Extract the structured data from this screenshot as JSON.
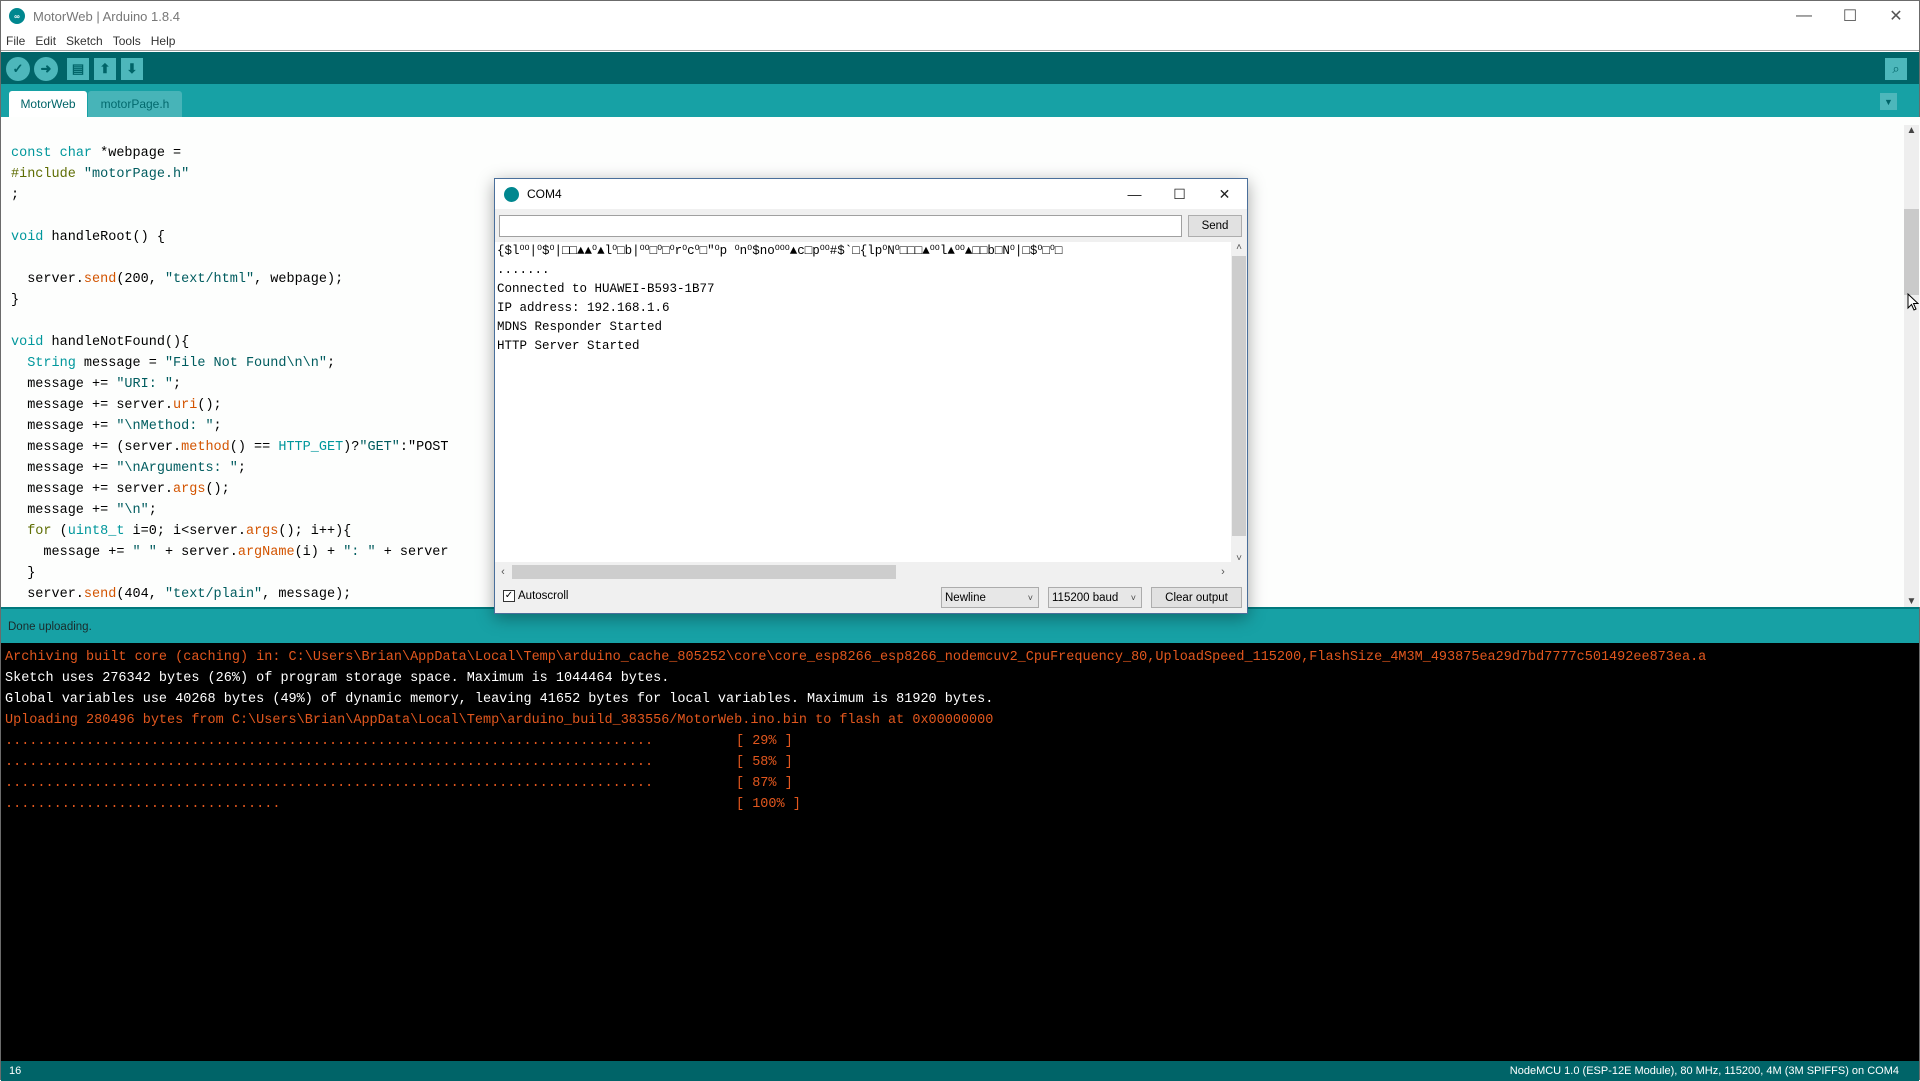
{
  "window": {
    "title": "MotorWeb | Arduino 1.8.4",
    "controls": {
      "minimize": "—",
      "maximize": "☐",
      "close": "✕"
    }
  },
  "menu": [
    "File",
    "Edit",
    "Sketch",
    "Tools",
    "Help"
  ],
  "toolbar": {
    "verify": "✓",
    "upload": "➜",
    "new": "▤",
    "open": "⬆",
    "save": "⬇",
    "serial_monitor": "⌕"
  },
  "tabs": [
    {
      "label": "MotorWeb",
      "active": true
    },
    {
      "label": "motorPage.h",
      "active": false
    }
  ],
  "tab_menu": "▼",
  "code_lines": [
    "const char *webpage =",
    "#include \"motorPage.h\"",
    ";",
    "",
    "void handleRoot() {",
    "",
    "  server.send(200, \"text/html\", webpage);",
    "}",
    "",
    "void handleNotFound(){",
    "  String message = \"File Not Found\\n\\n\";",
    "  message += \"URI: \";",
    "  message += server.uri();",
    "  message += \"\\nMethod: \";",
    "  message += (server.method() == HTTP_GET)?\"GET\":\"POST",
    "  message += \"\\nArguments: \";",
    "  message += server.args();",
    "  message += \"\\n\";",
    "  for (uint8_t i=0; i<server.args(); i++){",
    "    message += \" \" + server.argName(i) + \": \" + server",
    "  }",
    "  server.send(404, \"text/plain\", message);"
  ],
  "status": {
    "message": "Done uploading."
  },
  "console": {
    "lines": [
      {
        "text": "Archiving built core (caching) in: C:\\Users\\Brian\\AppData\\Local\\Temp\\arduino_cache_805252\\core\\core_esp8266_esp8266_nodemcuv2_CpuFrequency_80,UploadSpeed_115200,FlashSize_4M3M_493875ea29d7bd7777c501492ee873ea.a",
        "color": "orange"
      },
      {
        "text": "Sketch uses 276342 bytes (26%) of program storage space. Maximum is 1044464 bytes.",
        "color": "white"
      },
      {
        "text": "Global variables use 40268 bytes (49%) of dynamic memory, leaving 41652 bytes for local variables. Maximum is 81920 bytes.",
        "color": "white"
      },
      {
        "text": "Uploading 280496 bytes from C:\\Users\\Brian\\AppData\\Local\\Temp\\arduino_build_383556/MotorWeb.ino.bin to flash at 0x00000000",
        "color": "orange"
      }
    ],
    "progress": [
      {
        "dots": "................................................................................",
        "label": "[ 29% ]"
      },
      {
        "dots": "................................................................................",
        "label": "[ 58% ]"
      },
      {
        "dots": "................................................................................",
        "label": "[ 87% ]"
      },
      {
        "dots": "..................................",
        "label": "[ 100% ]"
      }
    ]
  },
  "footer": {
    "line_number": "16",
    "board_info": "NodeMCU 1.0 (ESP-12E Module), 80 MHz, 115200, 4M (3M SPIFFS) on COM4"
  },
  "serial_monitor": {
    "title": "COM4",
    "controls": {
      "minimize": "—",
      "maximize": "☐",
      "close": "✕"
    },
    "input_value": "",
    "send_label": "Send",
    "output_lines": [
      "{$l⁰⁰|⁰$⁰|□□▲▲⁰▲l⁰□b|⁰⁰□⁰□⁰r⁰c⁰□\"⁰p ⁰n⁰$no⁰⁰⁰▲c□p⁰⁰#$`□{lp⁰N⁰□□□▲⁰⁰l▲⁰⁰▲□□b□N⁰|□$⁰□⁰□",
      ".......",
      "Connected to HUAWEI-B593-1B77",
      "IP address: 192.168.1.6",
      "MDNS Responder Started",
      "HTTP Server Started"
    ],
    "autoscroll_label": "Autoscroll",
    "autoscroll_checked": true,
    "line_ending": "Newline",
    "baud_rate": "115200 baud",
    "clear_label": "Clear output"
  }
}
